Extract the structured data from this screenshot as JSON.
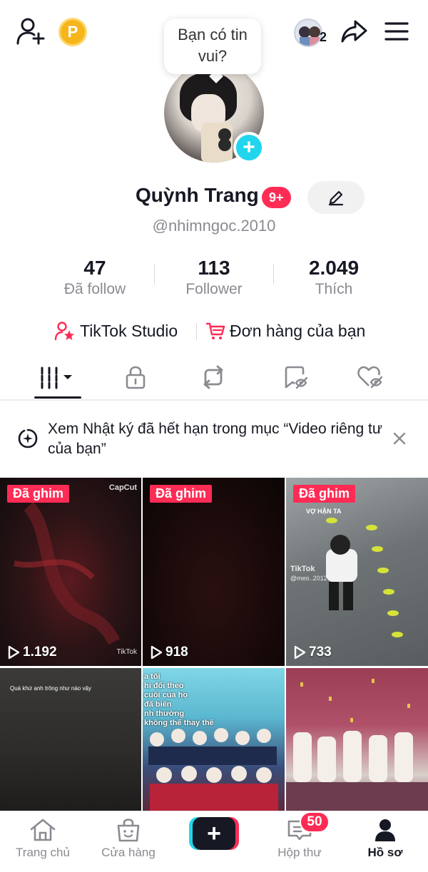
{
  "top_bar": {
    "coin_label": "P",
    "friends_count": "2",
    "icons": [
      "add-friend-icon",
      "coin-icon",
      "friends-avatar",
      "share-icon",
      "menu-icon"
    ]
  },
  "profile": {
    "bubble_text": "Bạn có tin vui?",
    "display_name": "Quỳnh Trang",
    "name_badge": "9+",
    "username": "@nhimngoc.2010",
    "add_icon": "+"
  },
  "stats": {
    "following": {
      "value": "47",
      "label": "Đã follow"
    },
    "followers": {
      "value": "113",
      "label": "Follower"
    },
    "likes": {
      "value": "2.049",
      "label": "Thích"
    }
  },
  "links": {
    "studio": "TikTok Studio",
    "orders": "Đơn hàng của bạn"
  },
  "tabs": [
    {
      "name": "videos",
      "icon": "grid-icon",
      "active": true
    },
    {
      "name": "private",
      "icon": "lock-icon"
    },
    {
      "name": "reposts",
      "icon": "repost-icon"
    },
    {
      "name": "favorites",
      "icon": "bookmark-icon"
    },
    {
      "name": "liked",
      "icon": "heart-icon"
    }
  ],
  "notice": {
    "text": "Xem Nhật ký đã hết hạn trong mục “Video riêng tư của bạn”"
  },
  "videos": [
    {
      "pinned_label": "Đã ghim",
      "views": "1.192",
      "watermark": "CapCut",
      "corner_mark": "TikTok"
    },
    {
      "pinned_label": "Đã ghim",
      "views": "918"
    },
    {
      "pinned_label": "Đã ghim",
      "views": "733",
      "overlay_text": "VỢ HẬN TA",
      "watermark": "TikTok",
      "watermark_handle": "@meo..2012"
    },
    {
      "overlay_text": "Quá khứ anh trông như nào vậy"
    },
    {
      "overlay_text": "a tôi\nhì đổi theo\ncuối của họ\nđã biến\nnh thường\nkhông thể thay thế"
    },
    {}
  ],
  "bottom_nav": {
    "home": "Trang chủ",
    "shop": "Cửa hàng",
    "create": "+",
    "inbox": "Hộp thư",
    "inbox_badge": "50",
    "profile": "Hồ sơ"
  },
  "colors": {
    "accent": "#fe2c55",
    "cyan": "#20d5ec",
    "text": "#161823",
    "muted": "#8a8b91"
  }
}
